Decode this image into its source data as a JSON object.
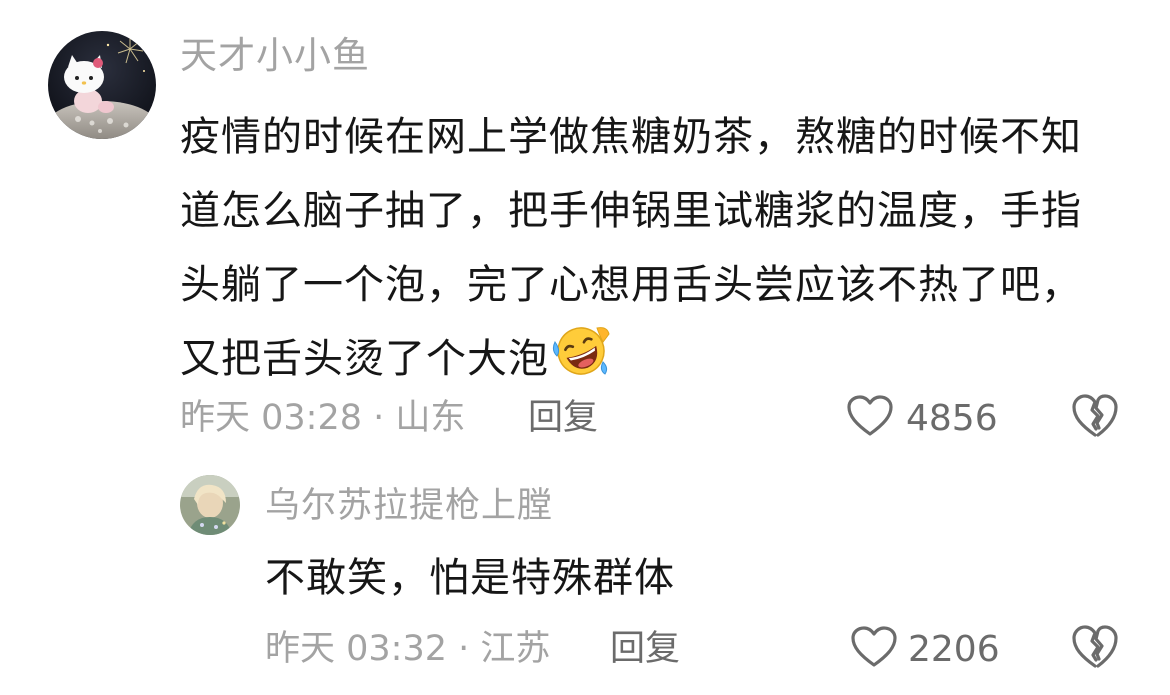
{
  "comments": [
    {
      "username": "天才小小鱼",
      "text": "疫情的时候在网上学做焦糖奶茶，熬糖的时候不知道怎么脑子抽了，把手伸锅里试糖浆的温度，手指头躺了一个泡，完了心想用舌头尝应该不热了吧，又把舌头烫了个大泡",
      "emoji": "rolling-on-floor-laughing-icon",
      "meta": "昨天 03:28 · 山东",
      "reply_label": "回复",
      "like_count": "4856"
    },
    {
      "username": "乌尔苏拉提枪上膛",
      "text": "不敢笑，怕是特殊群体",
      "meta": "昨天 03:32 · 江苏",
      "reply_label": "回复",
      "like_count": "2206"
    }
  ],
  "colors": {
    "username": "#a3a3a3",
    "text": "#161616",
    "meta": "#a3a3a3",
    "action": "#6b6b6b",
    "background": "#ffffff"
  }
}
